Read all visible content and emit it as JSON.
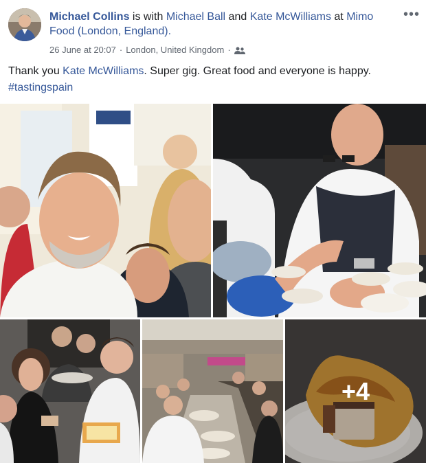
{
  "post": {
    "author": "Michael Collins",
    "is_with_text": "is with",
    "tagged_1": "Michael Ball",
    "and_text": "and",
    "tagged_2": "Kate McWilliams",
    "at_text": "at",
    "place": "Mimo Food (London, England).",
    "timestamp": "26 June at 20:07",
    "separator": "·",
    "location": "London, United Kingdom",
    "audience_icon": "friends-icon",
    "more_icon": "ellipsis-icon",
    "more_label": "•••",
    "text_prefix": "Thank you ",
    "mention": "Kate McWilliams",
    "text_suffix": ". Super gig. Great food and everyone is happy.",
    "hashtag": "#tastingspain"
  },
  "photos": {
    "count": 5,
    "extra_count_label": "+4",
    "items": [
      {
        "name": "selfie-photo"
      },
      {
        "name": "chef-plating-photo"
      },
      {
        "name": "guests-tasting-photo"
      },
      {
        "name": "event-hall-photo"
      },
      {
        "name": "food-closeup-photo"
      }
    ]
  },
  "colors": {
    "link": "#365899",
    "text": "#1c1e21",
    "meta": "#606770"
  }
}
